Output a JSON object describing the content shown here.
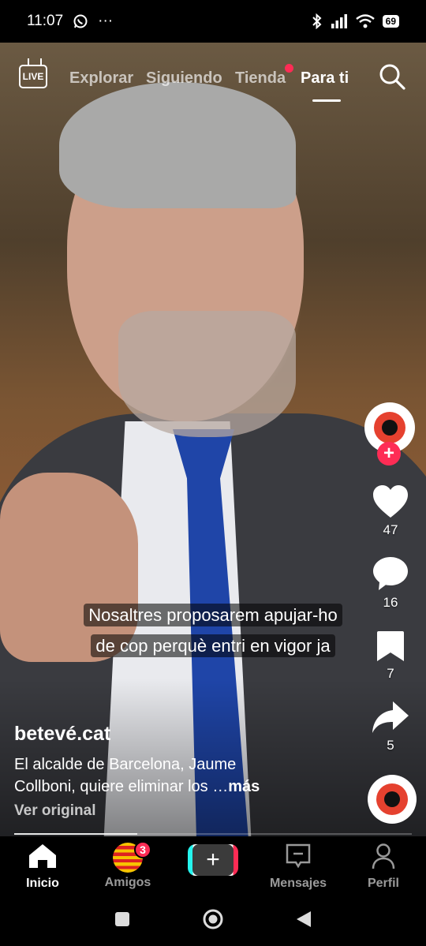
{
  "status_bar": {
    "time": "11:07",
    "whatsapp_icon": "whatsapp-icon",
    "more": "···",
    "battery": "69"
  },
  "top_nav": {
    "live_label": "LIVE",
    "tabs": [
      {
        "label": "Explorar"
      },
      {
        "label": "Siguiendo"
      },
      {
        "label": "Tienda"
      },
      {
        "label": "Para ti"
      }
    ],
    "active_tab": "Para ti"
  },
  "actions": {
    "likes": "47",
    "comments": "16",
    "saves": "7",
    "shares": "5"
  },
  "subtitles": {
    "line1": "Nosaltres proposarem apujar-ho",
    "line2": "de cop perquè entri en vigor ja"
  },
  "caption": {
    "author": "betevé.cat",
    "description_line1": "El alcalde de Barcelona, Jaume",
    "description_line2": "Collboni, quiere eliminar los …",
    "more": "más",
    "see_original": "Ver original"
  },
  "progress": {
    "value": 0.31
  },
  "bottom_nav": {
    "items": [
      {
        "label": "Inicio"
      },
      {
        "label": "Amigos",
        "badge": "3"
      },
      {
        "label": "Mensajes"
      },
      {
        "label": "Perfil"
      }
    ]
  },
  "colors": {
    "accent": "#fe2c55",
    "cyan": "#25f4ee"
  }
}
